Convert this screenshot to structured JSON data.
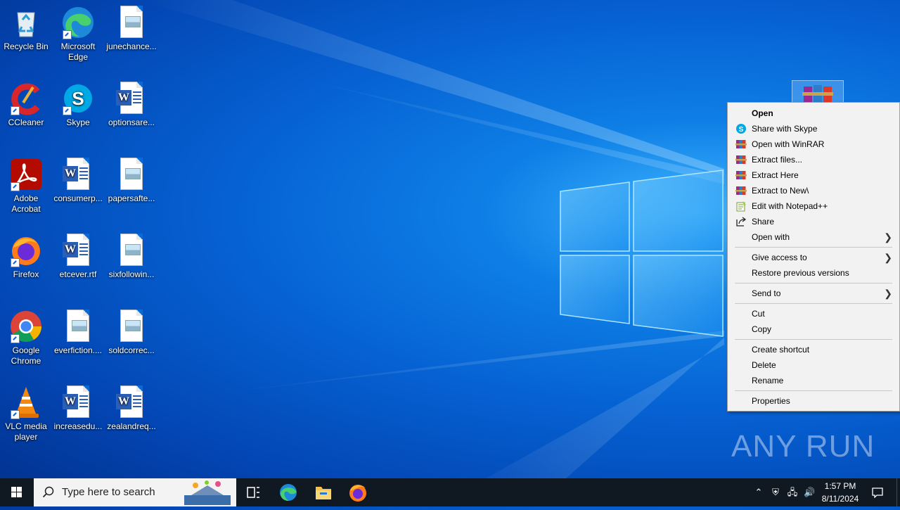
{
  "desktop": {
    "icons": [
      {
        "label": "Recycle Bin",
        "icon": "recycle-bin-icon"
      },
      {
        "label": "Microsoft Edge",
        "icon": "edge-icon"
      },
      {
        "label": "junechance...",
        "icon": "image-file-icon"
      },
      {
        "label": "CCleaner",
        "icon": "ccleaner-icon"
      },
      {
        "label": "Skype",
        "icon": "skype-icon"
      },
      {
        "label": "optionsare...",
        "icon": "word-file-icon"
      },
      {
        "label": "Adobe Acrobat",
        "icon": "acrobat-icon"
      },
      {
        "label": "consumerp...",
        "icon": "word-file-icon"
      },
      {
        "label": "papersafte...",
        "icon": "image-file-icon"
      },
      {
        "label": "Firefox",
        "icon": "firefox-icon"
      },
      {
        "label": "etcever.rtf",
        "icon": "word-file-icon"
      },
      {
        "label": "sixfollowin...",
        "icon": "image-file-icon"
      },
      {
        "label": "Google Chrome",
        "icon": "chrome-icon"
      },
      {
        "label": "everfiction....",
        "icon": "image-file-icon"
      },
      {
        "label": "soldcorrec...",
        "icon": "image-file-icon"
      },
      {
        "label": "VLC media player",
        "icon": "vlc-icon"
      },
      {
        "label": "increasedu...",
        "icon": "word-file-icon"
      },
      {
        "label": "zealandreq...",
        "icon": "word-file-icon"
      }
    ]
  },
  "context_menu": {
    "items": [
      {
        "label": "Open"
      },
      {
        "label": "Share with Skype",
        "icon": "skype-icon"
      },
      {
        "label": "Open with WinRAR",
        "icon": "winrar-icon"
      },
      {
        "label": "Extract files...",
        "icon": "winrar-icon"
      },
      {
        "label": "Extract Here",
        "icon": "winrar-icon"
      },
      {
        "label": "Extract to New\\",
        "icon": "winrar-icon"
      },
      {
        "label": "Edit with Notepad++",
        "icon": "notepadpp-icon"
      },
      {
        "label": "Share",
        "icon": "share-icon"
      },
      {
        "label": "Open with",
        "submenu": true
      },
      {
        "label": "Give access to",
        "submenu": true
      },
      {
        "label": "Restore previous versions"
      },
      {
        "label": "Send to",
        "submenu": true
      },
      {
        "label": "Cut"
      },
      {
        "label": "Copy"
      },
      {
        "label": "Create shortcut"
      },
      {
        "label": "Delete"
      },
      {
        "label": "Rename"
      },
      {
        "label": "Properties"
      }
    ]
  },
  "watermark": "ANY RUN",
  "taskbar": {
    "search_placeholder": "Type here to search",
    "time": "1:57 PM",
    "date": "8/11/2024"
  },
  "colors": {
    "taskbar": "#101822",
    "menu_bg": "#f2f2f2",
    "desktop_accent": "#0a78e8"
  }
}
